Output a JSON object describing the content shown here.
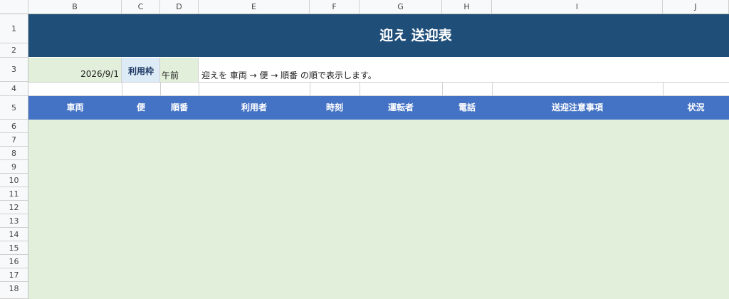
{
  "columns": [
    "B",
    "C",
    "D",
    "E",
    "F",
    "G",
    "H",
    "I",
    "J"
  ],
  "rows": [
    "1",
    "2",
    "3",
    "4",
    "5",
    "6",
    "7",
    "8",
    "9",
    "10",
    "11",
    "12",
    "13",
    "14",
    "15",
    "16",
    "17",
    "18"
  ],
  "title": "迎え 送迎表",
  "date": "2026/9/1",
  "label_box": "利用枠",
  "slot": "午前",
  "note": "迎えを 車両 → 便 → 順番 の順で表示します。",
  "headers": [
    "車両",
    "便",
    "順番",
    "利用者",
    "時刻",
    "運転者",
    "電話",
    "送迎注意事項",
    "状況"
  ],
  "colors": {
    "title_bg": "#1f4e79",
    "header_bg": "#4472c4",
    "body_bg": "#e2efda",
    "label_bg": "#ddebf7"
  }
}
